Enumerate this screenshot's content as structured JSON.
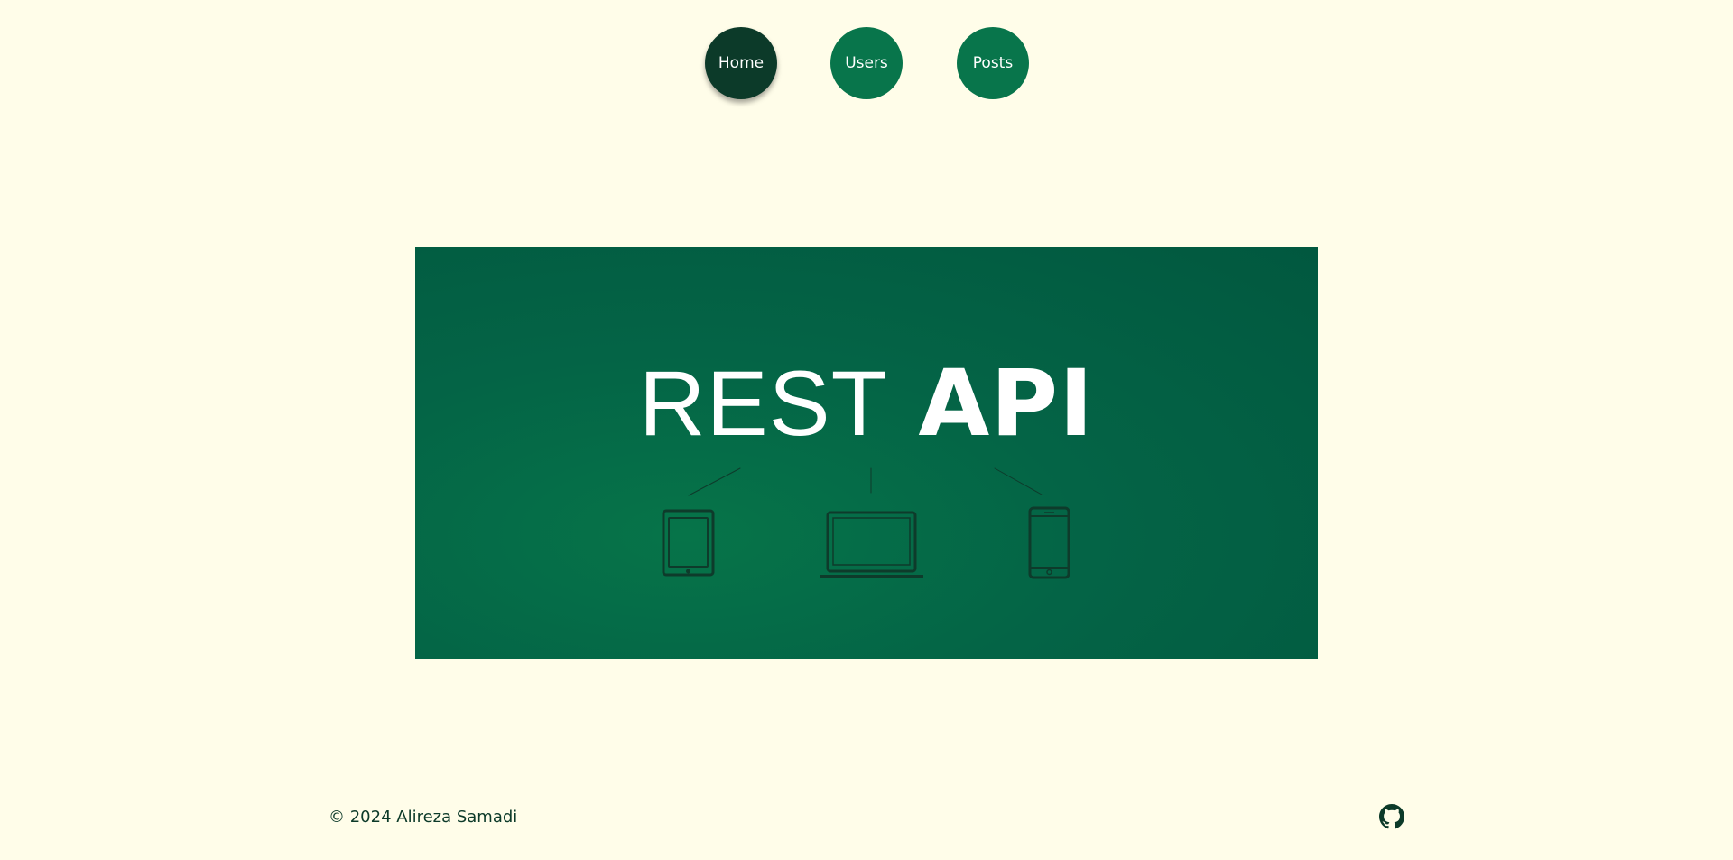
{
  "nav": {
    "items": [
      {
        "label": "Home",
        "active": true
      },
      {
        "label": "Users",
        "active": false
      },
      {
        "label": "Posts",
        "active": false
      }
    ]
  },
  "hero": {
    "title_light": "REST",
    "title_bold": "API",
    "devices": [
      "tablet-icon",
      "laptop-icon",
      "phone-icon"
    ]
  },
  "footer": {
    "copyright": "© 2024 Alireza Samadi",
    "link_icon": "github-icon"
  },
  "colors": {
    "background": "#fffde9",
    "nav_button": "#08754b",
    "nav_active": "#0c3a29",
    "hero_green": "#046446",
    "footer_text": "#0c3a29"
  }
}
